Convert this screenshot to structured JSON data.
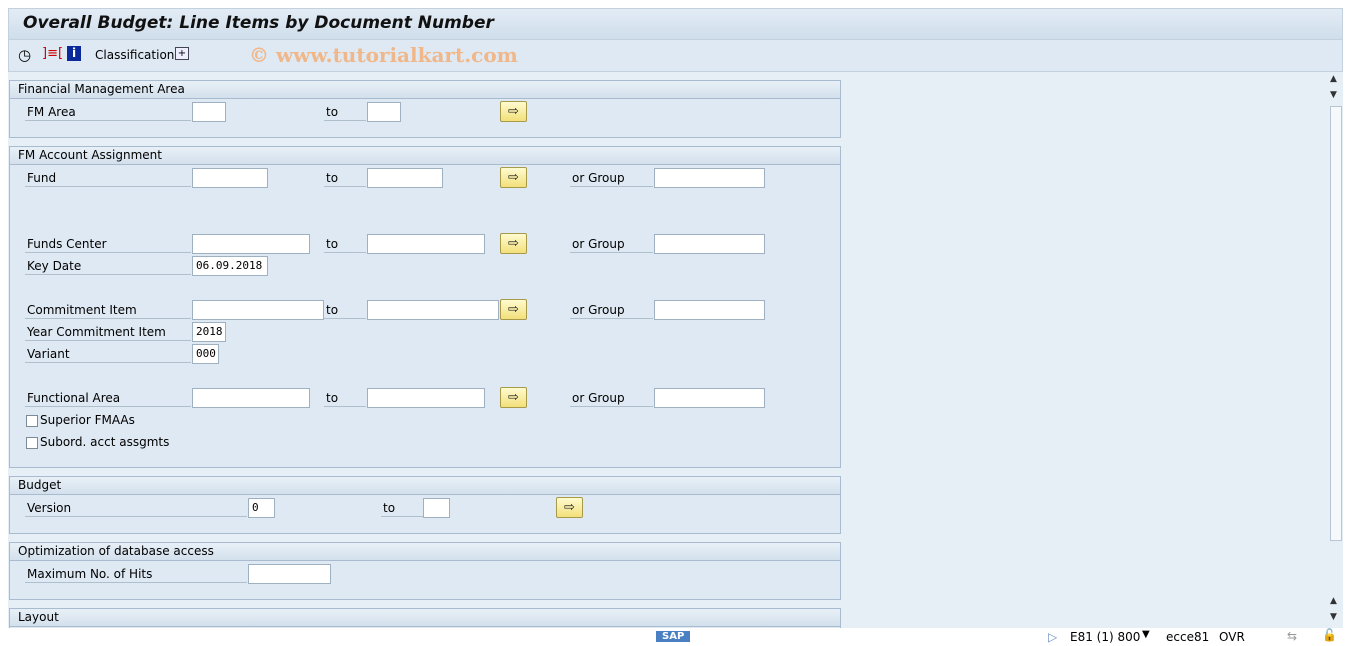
{
  "window": {
    "title": "Overall Budget: Line Items by Document Number",
    "watermark": "© www.tutorialkart.com"
  },
  "toolbar": {
    "execute_icon": "clock-check-icon",
    "layout_icon": "bracket-color-icon",
    "info_icon": "info-icon",
    "classification": "Classification",
    "tree_icon": "add-node-icon"
  },
  "groups": {
    "fm_area": {
      "title": "Financial Management Area",
      "fm_area": "FM Area",
      "to": "to",
      "from_value": "",
      "to_value": ""
    },
    "assignment": {
      "title": "FM Account Assignment",
      "fund": "Fund",
      "funds_center": "Funds Center",
      "key_date": "Key Date",
      "key_date_value": "06.09.2018",
      "commitment_item": "Commitment Item",
      "year_commitment_item": "Year Commitment Item",
      "year_value": "2018",
      "variant": "Variant",
      "variant_value": "000",
      "functional_area": "Functional Area",
      "to": "to",
      "or_group": "or Group",
      "superior": "Superior FMAAs",
      "subord": "Subord. acct assgmts"
    },
    "budget": {
      "title": "Budget",
      "version": "Version",
      "version_value": "0",
      "to": "to"
    },
    "optimization": {
      "title": "Optimization of database access",
      "max_hits": "Maximum No. of Hits",
      "max_hits_value": ""
    },
    "layout": {
      "title": "Layout"
    }
  },
  "status": {
    "sap_logo": "SAP",
    "system": "E81 (1) 800",
    "server": "ecce81",
    "mode": "OVR"
  }
}
